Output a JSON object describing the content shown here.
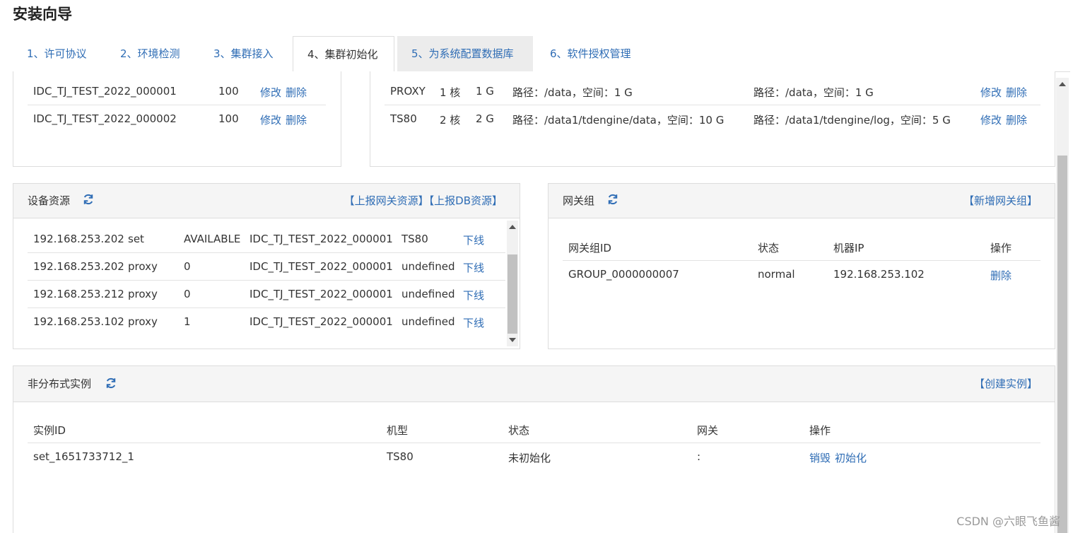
{
  "page": {
    "title": "安装向导"
  },
  "tabs": [
    {
      "label": "1、许可协议"
    },
    {
      "label": "2、环境检测"
    },
    {
      "label": "3、集群接入"
    },
    {
      "label": "4、集群初始化"
    },
    {
      "label": "5、为系统配置数据库"
    },
    {
      "label": "6、软件授权管理"
    }
  ],
  "top_left": {
    "rows": [
      {
        "name": "IDC_TJ_TEST_2022_000001",
        "count": "100",
        "edit": "修改",
        "delete": "删除"
      },
      {
        "name": "IDC_TJ_TEST_2022_000002",
        "count": "100",
        "edit": "修改",
        "delete": "删除"
      }
    ]
  },
  "top_right": {
    "rows": [
      {
        "type": "PROXY",
        "cpu": "1 核",
        "mem": "1 G",
        "data": "路径：/data，空间：1 G",
        "log": "路径：/data，空间：1 G",
        "edit": "修改",
        "delete": "删除"
      },
      {
        "type": "TS80",
        "cpu": "2 核",
        "mem": "2 G",
        "data": "路径：/data1/tdengine/data，空间：10 G",
        "log": "路径：/data1/tdengine/log，空间：5 G",
        "edit": "修改",
        "delete": "删除"
      }
    ]
  },
  "device": {
    "title": "设备资源",
    "action1": "【上报网关资源】",
    "action2": "【上报DB资源】",
    "rows": [
      {
        "ip": "192.168.253.202",
        "type": "set",
        "status": "AVAILABLE",
        "idc": "IDC_TJ_TEST_2022_000001",
        "model": "TS80",
        "op": "下线"
      },
      {
        "ip": "192.168.253.202",
        "type": "proxy",
        "status": "0",
        "idc": "IDC_TJ_TEST_2022_000001",
        "model": "undefined",
        "op": "下线"
      },
      {
        "ip": "192.168.253.212",
        "type": "proxy",
        "status": "0",
        "idc": "IDC_TJ_TEST_2022_000001",
        "model": "undefined",
        "op": "下线"
      },
      {
        "ip": "192.168.253.102",
        "type": "proxy",
        "status": "1",
        "idc": "IDC_TJ_TEST_2022_000001",
        "model": "undefined",
        "op": "下线"
      }
    ]
  },
  "gateway": {
    "title": "网关组",
    "action": "【新增网关组】",
    "headers": {
      "id": "网关组ID",
      "status": "状态",
      "ip": "机器IP",
      "op": "操作"
    },
    "rows": [
      {
        "id": "GROUP_0000000007",
        "status": "normal",
        "ip": "192.168.253.102",
        "op": "删除"
      }
    ]
  },
  "instance": {
    "title": "非分布式实例",
    "action": "【创建实例】",
    "headers": {
      "id": "实例ID",
      "model": "机型",
      "status": "状态",
      "gateway": "网关",
      "op": "操作"
    },
    "rows": [
      {
        "id": "set_1651733712_1",
        "model": "TS80",
        "status": "未初始化",
        "gateway": ":",
        "destroy": "销毁",
        "init": "初始化"
      }
    ]
  },
  "watermark": "CSDN @六眼飞鱼酱"
}
